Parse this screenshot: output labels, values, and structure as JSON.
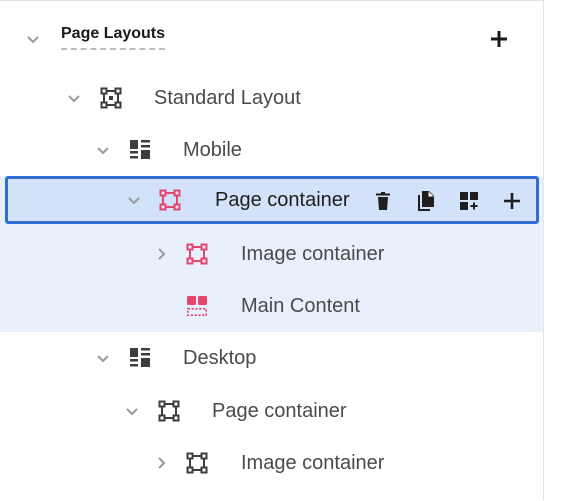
{
  "header": {
    "title": "Page Layouts"
  },
  "tree": {
    "standard_layout": "Standard Layout",
    "mobile": "Mobile",
    "mobile_page_container": "Page container",
    "mobile_image_container": "Image container",
    "mobile_main_content": "Main Content",
    "desktop": "Desktop",
    "desktop_page_container": "Page container",
    "desktop_image_container": "Image container"
  },
  "colors": {
    "selection_border": "#2f6fd4",
    "selection_fill": "#d2e2f8",
    "selection_band": "#e8f0fc",
    "component_icon": "#e5466f",
    "neutral_icon": "#3d3d3d"
  },
  "icons": {
    "layout": "layout-frame-icon",
    "breakpoint": "breakpoint-grid-icon",
    "container": "container-frame-icon",
    "content": "content-slot-icon",
    "delete": "trash-icon",
    "duplicate": "copy-icon",
    "add_child": "add-widget-icon",
    "add": "plus-icon"
  }
}
